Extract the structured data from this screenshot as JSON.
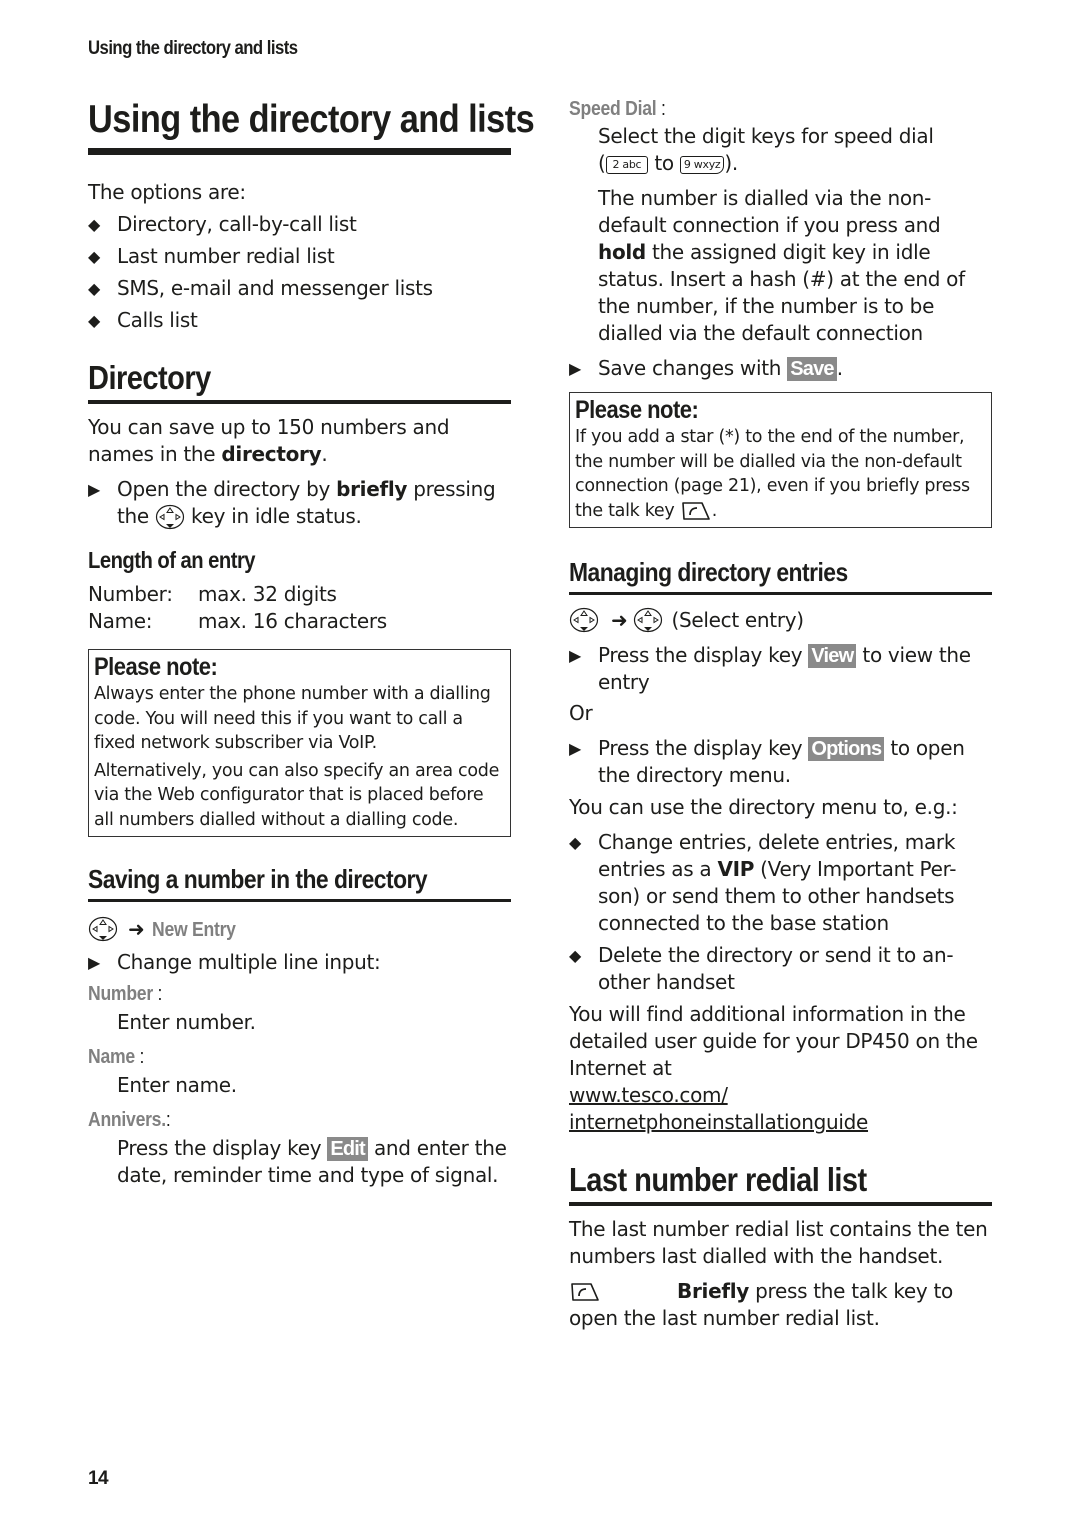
{
  "running_header": "Using the directory and lists",
  "page_number": "14",
  "colors": {
    "text": "#1d1d1b",
    "label_grey": "#808080",
    "softkey_bg": "#8a8a8a"
  },
  "left": {
    "title": "Using the directory and lists",
    "intro": "The options are:",
    "options": [
      "Directory, call-by-call list",
      "Last number redial list",
      "SMS, e-mail and messenger lists",
      "Calls list"
    ],
    "directory": {
      "heading": "Directory",
      "text_pre": "You can save up to 150 numbers and names in the ",
      "text_bold": "directory",
      "text_post": ".",
      "step_pre": "Open the directory by ",
      "step_bold": "briefly",
      "step_mid": " pressing the ",
      "step_icon": "nav-key-icon",
      "step_post": " key in idle status."
    },
    "length": {
      "heading": "Length of an entry",
      "rows": [
        {
          "label": "Number:",
          "value": "max. 32 digits"
        },
        {
          "label": "Name:",
          "value": "max. 16 characters"
        }
      ]
    },
    "note": {
      "title": "Please note:",
      "p1": "Always enter the phone number with a dialling code. You will need this if you want to call a fixed network subscriber via VoIP.",
      "p2": "Alternatively, you can also specify an area code via the Web configurator that is placed before all numbers dialled without a dialling code."
    },
    "saving": {
      "heading": "Saving a number in the directory",
      "menu_path": "New Entry",
      "step": "Change multiple line input:",
      "fields": [
        {
          "label": "Number",
          "suffix": " :",
          "desc": "Enter number."
        },
        {
          "label": "Name",
          "suffix": " :",
          "desc": "Enter name."
        }
      ],
      "annivers": {
        "label": "Annivers.",
        "suffix": ":",
        "desc_pre": "Press the display key ",
        "softkey": "Edit",
        "desc_post": " and enter the date, reminder time and type of signal."
      }
    }
  },
  "right": {
    "speed_dial": {
      "label": "Speed Dial",
      "suffix": " :",
      "line1": "Select the digit keys for speed dial",
      "key_from": "2 abc",
      "key_to": "9 wxyz",
      "to_word": "to",
      "p_pre": "The number is dialled via the non-default connection if you press and ",
      "p_bold": "hold",
      "p_post": " the assigned digit key in idle status. Insert a hash (#) at the end of the number, if the number is to be dialled via the default connection",
      "save_pre": "Save changes with ",
      "save_key": "Save",
      "save_post": "."
    },
    "note": {
      "title": "Please note:",
      "text": "If you add a star (*) to the end of the number, the number will be dialled via the non-default connection (page 21), even if you briefly press the talk key "
    },
    "managing": {
      "heading": "Managing directory entries",
      "path_text": "(Select entry)",
      "step1_pre": "Press the display key ",
      "step1_key": "View",
      "step1_post": " to view the entry",
      "or": "Or",
      "step2_pre": "Press the display key ",
      "step2_key": "Options",
      "step2_post": " to open the directory menu.",
      "menu_intro": "You can use the directory menu to, e.g.:",
      "bullet1_pre": "Change entries, delete entries, mark entries as a ",
      "bullet1_bold": "VIP",
      "bullet1_post": " (Very Important Per-son) or send them to other handsets connected to the base station",
      "bullet2": "Delete the directory or send it to an-other handset",
      "info": "You will find additional information in the detailed user guide for your DP450 on the Internet at",
      "link1": "www.tesco.com/",
      "link2": "internetphoneinstallationguide"
    },
    "redial": {
      "heading": "Last number redial list",
      "text": "The last number redial list contains the ten numbers last dialled with the handset.",
      "step_bold": "Briefly",
      "step_post": " press the talk key to open the last number redial list."
    }
  }
}
